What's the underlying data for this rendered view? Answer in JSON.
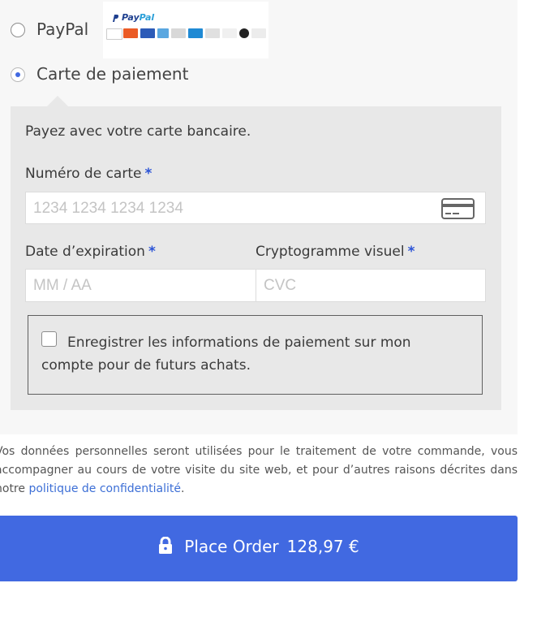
{
  "payment_methods": {
    "paypal_label": "PayPal",
    "paypal_logo_text": "PayPal",
    "card_label": "Carte de paiement",
    "selected": "card"
  },
  "card_form": {
    "description": "Payez avec votre carte bancaire.",
    "required_mark": "*",
    "card_number_label": "Numéro de carte",
    "card_number_placeholder": "1234 1234 1234 1234",
    "expiry_label": "Date d’expiration",
    "expiry_placeholder": "MM / AA",
    "cvc_label": "Cryptogramme visuel",
    "cvc_placeholder": "CVC",
    "save_info_label": "Enregistrer les informations de paiement sur mon compte pour de futurs achats.",
    "save_info_checked": false
  },
  "privacy": {
    "text": "Vos données personnelles seront utilisées pour le traitement de votre commande, vous accompagner au cours de votre visite du site web, et pour d’autres raisons décrites dans notre ",
    "link_text": "politique de confidentialité",
    "suffix": "."
  },
  "order_button": {
    "label": "Place Order",
    "amount": "128,97 €",
    "icon": "lock-icon"
  },
  "colors": {
    "accent": "#4169e1",
    "required": "#2b53d6",
    "link": "#3d6fd6"
  }
}
